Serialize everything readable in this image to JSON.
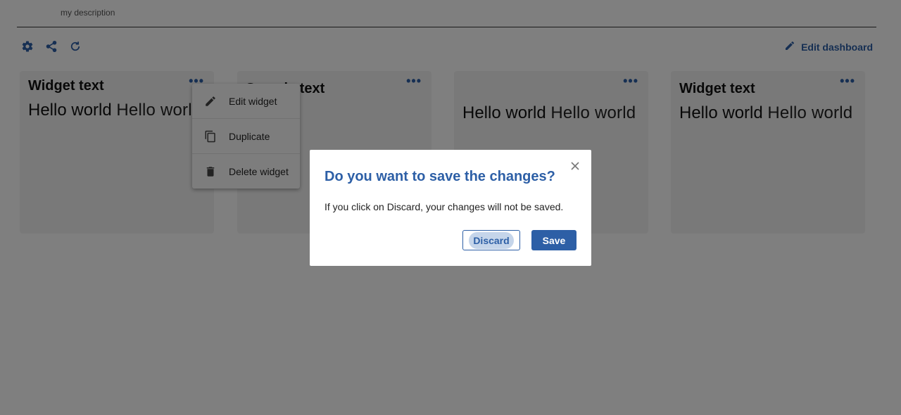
{
  "header": {
    "description": "my description"
  },
  "toolbar": {
    "icons": [
      "gear-icon",
      "share-icon",
      "refresh-icon"
    ],
    "edit_dashboard_label": "Edit dashboard"
  },
  "widgets": [
    {
      "title": "Widget text",
      "body_bold": "Hello world",
      "body_light": "Hello world"
    },
    {
      "title": "Sample text",
      "body_bold": "",
      "body_light": ""
    },
    {
      "title": "",
      "body_bold": "Hello world",
      "body_light": "Hello world"
    },
    {
      "title": "Widget text",
      "body_bold": "Hello world",
      "body_light": "Hello world"
    }
  ],
  "context_menu": {
    "items": [
      {
        "label": "Edit widget",
        "icon": "pencil-icon"
      },
      {
        "label": "Duplicate",
        "icon": "copy-icon"
      },
      {
        "label": "Delete widget",
        "icon": "trash-icon"
      }
    ]
  },
  "dialog": {
    "title": "Do you want to save the changes?",
    "message": "If you click on Discard, your changes will not be saved.",
    "discard_label": "Discard",
    "save_label": "Save"
  },
  "colors": {
    "accent": "#2d5fa6",
    "overlay": "rgba(0,0,0,0.5)"
  }
}
